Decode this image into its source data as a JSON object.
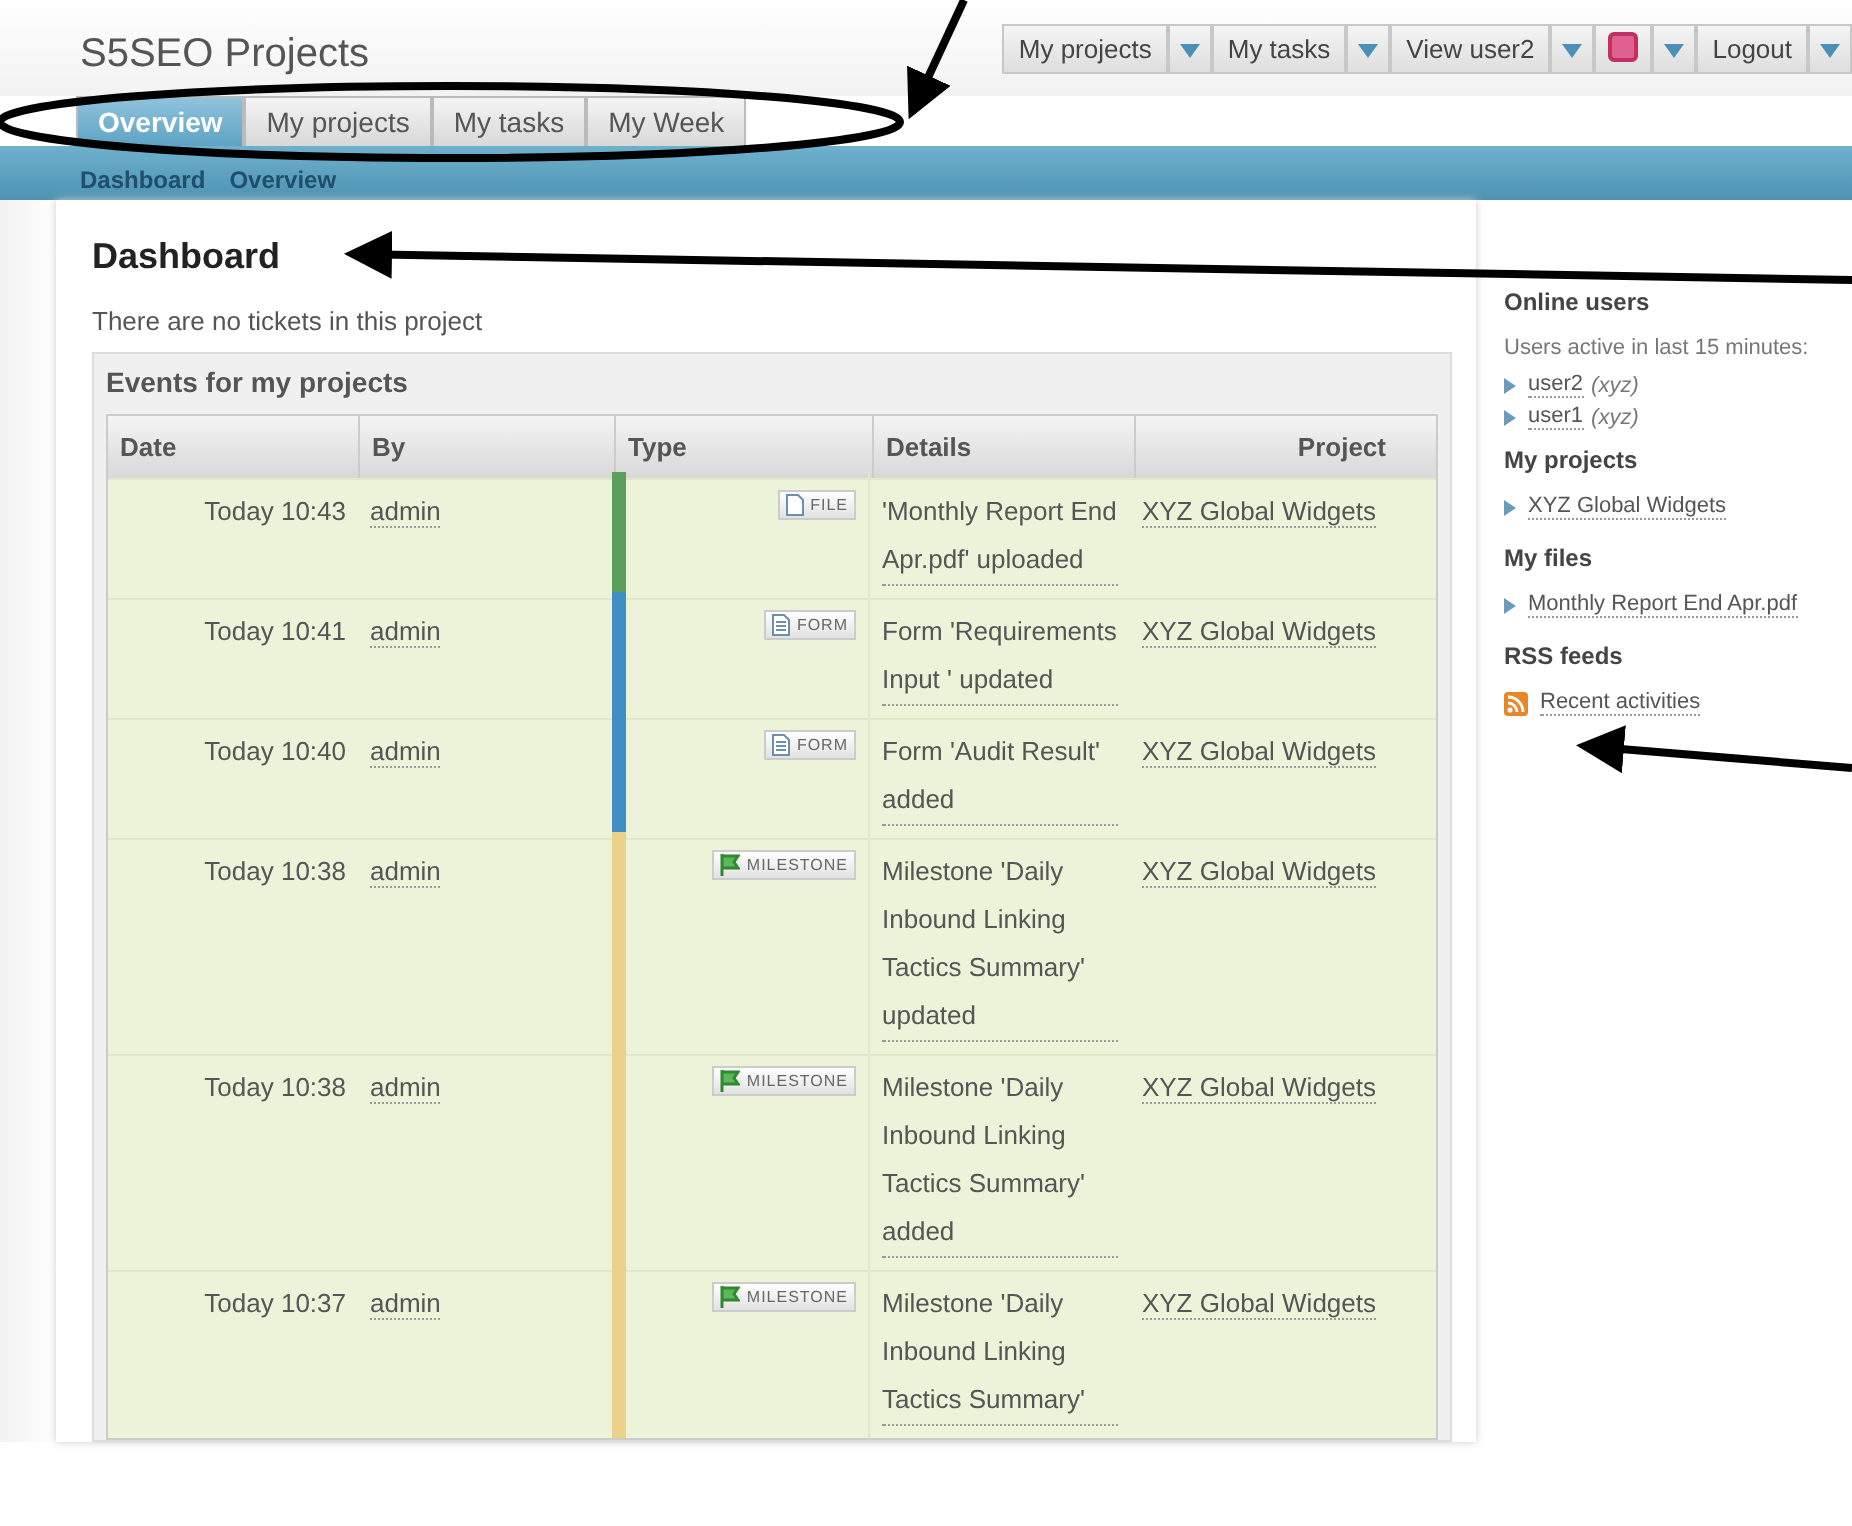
{
  "header": {
    "title": "S5SEO Projects",
    "menu": [
      {
        "label": "My projects",
        "kind": "text"
      },
      {
        "label": "My tasks",
        "kind": "text"
      },
      {
        "label": "View user2",
        "kind": "text"
      },
      {
        "kind": "icon"
      },
      {
        "label": "Logout",
        "kind": "text"
      }
    ]
  },
  "tabs": [
    {
      "label": "Overview",
      "selected": true
    },
    {
      "label": "My projects",
      "selected": false
    },
    {
      "label": "My tasks",
      "selected": false
    },
    {
      "label": "My Week",
      "selected": false
    }
  ],
  "subnav": [
    "Dashboard",
    "Overview"
  ],
  "main": {
    "heading": "Dashboard",
    "notice": "There are no tickets in this project",
    "panel_title": "Events for my projects",
    "columns": [
      "Date",
      "By",
      "Type",
      "Details",
      "Project"
    ],
    "rows": [
      {
        "date": "Today 10:43",
        "by": "admin",
        "kind": "file",
        "type": "FILE",
        "color": "#5c9e5c",
        "details": "'Monthly Report End Apr.pdf' uploaded",
        "project": "XYZ Global Widgets"
      },
      {
        "date": "Today 10:41",
        "by": "admin",
        "kind": "form",
        "type": "FORM",
        "color": "#3d8fc4",
        "details": "Form 'Requirements Input ' updated",
        "project": "XYZ Global Widgets"
      },
      {
        "date": "Today 10:40",
        "by": "admin",
        "kind": "form",
        "type": "FORM",
        "color": "#3d8fc4",
        "details": "Form 'Audit Result' added",
        "project": "XYZ Global Widgets"
      },
      {
        "date": "Today 10:38",
        "by": "admin",
        "kind": "milestone",
        "type": "MILESTONE",
        "color": "#ead28a",
        "details": "Milestone 'Daily Inbound Linking Tactics Summary' updated",
        "project": "XYZ Global Widgets"
      },
      {
        "date": "Today 10:38",
        "by": "admin",
        "kind": "milestone",
        "type": "MILESTONE",
        "color": "#ead28a",
        "details": "Milestone 'Daily Inbound Linking Tactics Summary' added",
        "project": "XYZ Global Widgets"
      },
      {
        "date": "Today 10:37",
        "by": "admin",
        "kind": "milestone",
        "type": "MILESTONE",
        "color": "#ead28a",
        "details": "Milestone 'Daily Inbound Linking Tactics Summary'",
        "project": "XYZ Global Widgets"
      }
    ]
  },
  "sidebar": {
    "online_title": "Online users",
    "online_note": "Users active in last 15 minutes:",
    "users": [
      {
        "name": "user2",
        "note": "(xyz)"
      },
      {
        "name": "user1",
        "note": "(xyz)"
      }
    ],
    "projects_title": "My projects",
    "projects": [
      "XYZ Global Widgets"
    ],
    "files_title": "My files",
    "files": [
      "Monthly Report End Apr.pdf"
    ],
    "rss_title": "RSS feeds",
    "feeds": [
      "Recent activities"
    ]
  }
}
